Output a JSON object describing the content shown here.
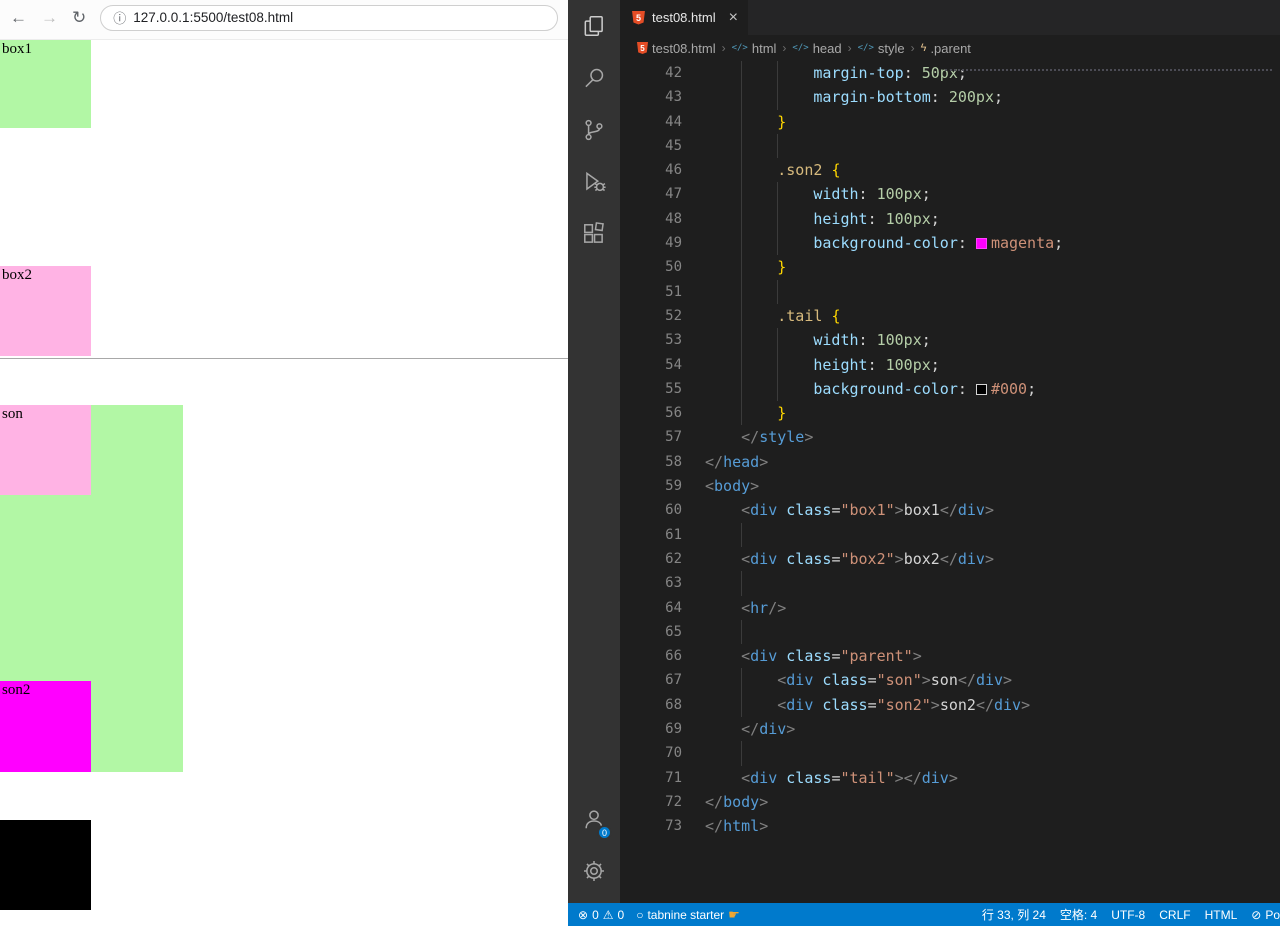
{
  "browser": {
    "toolbar": {
      "back_icon": "←",
      "forward_icon": "→",
      "reload_icon": "↻",
      "info_icon": "ⓘ",
      "url": "127.0.0.1:5500/test08.html"
    },
    "page": {
      "box1": {
        "label": "box1",
        "bg": "#b2f7a5"
      },
      "box2": {
        "label": "box2",
        "bg": "#ffb3e4"
      },
      "parent": {
        "bg": "#b2f7a5"
      },
      "son": {
        "label": "son",
        "bg": "#ffb3e4"
      },
      "son2": {
        "label": "son2",
        "bg": "#ff00ff"
      },
      "tail": {
        "bg": "#000000"
      }
    }
  },
  "vscode": {
    "tab": {
      "title": "test08.html",
      "close_icon": "×",
      "file_icon": "5"
    },
    "breadcrumb": {
      "separator": "›",
      "items": [
        {
          "label": "test08.html",
          "icon": "html5"
        },
        {
          "label": "html",
          "icon": "element"
        },
        {
          "label": "head",
          "icon": "element"
        },
        {
          "label": "style",
          "icon": "element"
        },
        {
          "label": ".parent",
          "icon": "rule"
        }
      ]
    },
    "code": {
      "lines": [
        {
          "n": 42,
          "g": [
            4,
            8
          ],
          "t": [
            [
              "s",
              "            "
            ],
            [
              "p",
              "margin-top"
            ],
            [
              "u",
              ": "
            ],
            [
              "n",
              "50px"
            ],
            [
              "u",
              ";"
            ]
          ]
        },
        {
          "n": 43,
          "g": [
            4,
            8
          ],
          "t": [
            [
              "s",
              "            "
            ],
            [
              "p",
              "margin-bottom"
            ],
            [
              "u",
              ": "
            ],
            [
              "n",
              "200px"
            ],
            [
              "u",
              ";"
            ]
          ]
        },
        {
          "n": 44,
          "g": [
            4
          ],
          "t": [
            [
              "s",
              "        "
            ],
            [
              "b",
              "}"
            ]
          ]
        },
        {
          "n": 45,
          "g": [
            4,
            8
          ],
          "t": []
        },
        {
          "n": 46,
          "g": [
            4
          ],
          "t": [
            [
              "s",
              "        "
            ],
            [
              "c",
              ".son2"
            ],
            [
              "s",
              " "
            ],
            [
              "b",
              "{"
            ]
          ]
        },
        {
          "n": 47,
          "g": [
            4,
            8
          ],
          "t": [
            [
              "s",
              "            "
            ],
            [
              "p",
              "width"
            ],
            [
              "u",
              ": "
            ],
            [
              "n",
              "100px"
            ],
            [
              "u",
              ";"
            ]
          ]
        },
        {
          "n": 48,
          "g": [
            4,
            8
          ],
          "t": [
            [
              "s",
              "            "
            ],
            [
              "p",
              "height"
            ],
            [
              "u",
              ": "
            ],
            [
              "n",
              "100px"
            ],
            [
              "u",
              ";"
            ]
          ]
        },
        {
          "n": 49,
          "g": [
            4,
            8
          ],
          "t": [
            [
              "s",
              "            "
            ],
            [
              "p",
              "background-color"
            ],
            [
              "u",
              ": "
            ],
            [
              "w",
              "#ff00ff"
            ],
            [
              "v",
              "magenta"
            ],
            [
              "u",
              ";"
            ]
          ]
        },
        {
          "n": 50,
          "g": [
            4
          ],
          "t": [
            [
              "s",
              "        "
            ],
            [
              "b",
              "}"
            ]
          ]
        },
        {
          "n": 51,
          "g": [
            4,
            8
          ],
          "t": []
        },
        {
          "n": 52,
          "g": [
            4
          ],
          "t": [
            [
              "s",
              "        "
            ],
            [
              "c",
              ".tail"
            ],
            [
              "s",
              " "
            ],
            [
              "b",
              "{"
            ]
          ]
        },
        {
          "n": 53,
          "g": [
            4,
            8
          ],
          "t": [
            [
              "s",
              "            "
            ],
            [
              "p",
              "width"
            ],
            [
              "u",
              ": "
            ],
            [
              "n",
              "100px"
            ],
            [
              "u",
              ";"
            ]
          ]
        },
        {
          "n": 54,
          "g": [
            4,
            8
          ],
          "t": [
            [
              "s",
              "            "
            ],
            [
              "p",
              "height"
            ],
            [
              "u",
              ": "
            ],
            [
              "n",
              "100px"
            ],
            [
              "u",
              ";"
            ]
          ]
        },
        {
          "n": 55,
          "g": [
            4,
            8
          ],
          "t": [
            [
              "s",
              "            "
            ],
            [
              "p",
              "background-color"
            ],
            [
              "u",
              ": "
            ],
            [
              "w",
              "#000000"
            ],
            [
              "v",
              "#000"
            ],
            [
              "u",
              ";"
            ]
          ]
        },
        {
          "n": 56,
          "g": [
            4
          ],
          "t": [
            [
              "s",
              "        "
            ],
            [
              "b",
              "}"
            ]
          ]
        },
        {
          "n": 57,
          "g": [],
          "t": [
            [
              "s",
              "    "
            ],
            [
              "a",
              "</"
            ],
            [
              "t",
              "style"
            ],
            [
              "a",
              ">"
            ]
          ]
        },
        {
          "n": 58,
          "g": [],
          "t": [
            [
              "a",
              "</"
            ],
            [
              "t",
              "head"
            ],
            [
              "a",
              ">"
            ]
          ]
        },
        {
          "n": 59,
          "g": [],
          "t": [
            [
              "a",
              "<"
            ],
            [
              "t",
              "body"
            ],
            [
              "a",
              ">"
            ]
          ]
        },
        {
          "n": 60,
          "g": [],
          "t": [
            [
              "s",
              "    "
            ],
            [
              "a",
              "<"
            ],
            [
              "t",
              "div"
            ],
            [
              "s",
              " "
            ],
            [
              "r",
              "class"
            ],
            [
              "u",
              "="
            ],
            [
              "q",
              "\"box1\""
            ],
            [
              "a",
              ">"
            ],
            [
              "x",
              "box1"
            ],
            [
              "a",
              "</"
            ],
            [
              "t",
              "div"
            ],
            [
              "a",
              ">"
            ]
          ]
        },
        {
          "n": 61,
          "g": [
            4
          ],
          "t": []
        },
        {
          "n": 62,
          "g": [],
          "t": [
            [
              "s",
              "    "
            ],
            [
              "a",
              "<"
            ],
            [
              "t",
              "div"
            ],
            [
              "s",
              " "
            ],
            [
              "r",
              "class"
            ],
            [
              "u",
              "="
            ],
            [
              "q",
              "\"box2\""
            ],
            [
              "a",
              ">"
            ],
            [
              "x",
              "box2"
            ],
            [
              "a",
              "</"
            ],
            [
              "t",
              "div"
            ],
            [
              "a",
              ">"
            ]
          ]
        },
        {
          "n": 63,
          "g": [
            4
          ],
          "t": []
        },
        {
          "n": 64,
          "g": [],
          "t": [
            [
              "s",
              "    "
            ],
            [
              "a",
              "<"
            ],
            [
              "t",
              "hr"
            ],
            [
              "a",
              "/>"
            ]
          ]
        },
        {
          "n": 65,
          "g": [
            4
          ],
          "t": []
        },
        {
          "n": 66,
          "g": [],
          "t": [
            [
              "s",
              "    "
            ],
            [
              "a",
              "<"
            ],
            [
              "t",
              "div"
            ],
            [
              "s",
              " "
            ],
            [
              "r",
              "class"
            ],
            [
              "u",
              "="
            ],
            [
              "q",
              "\"parent\""
            ],
            [
              "a",
              ">"
            ]
          ]
        },
        {
          "n": 67,
          "g": [
            4
          ],
          "t": [
            [
              "s",
              "        "
            ],
            [
              "a",
              "<"
            ],
            [
              "t",
              "div"
            ],
            [
              "s",
              " "
            ],
            [
              "r",
              "class"
            ],
            [
              "u",
              "="
            ],
            [
              "q",
              "\"son\""
            ],
            [
              "a",
              ">"
            ],
            [
              "x",
              "son"
            ],
            [
              "a",
              "</"
            ],
            [
              "t",
              "div"
            ],
            [
              "a",
              ">"
            ]
          ]
        },
        {
          "n": 68,
          "g": [
            4
          ],
          "t": [
            [
              "s",
              "        "
            ],
            [
              "a",
              "<"
            ],
            [
              "t",
              "div"
            ],
            [
              "s",
              " "
            ],
            [
              "r",
              "class"
            ],
            [
              "u",
              "="
            ],
            [
              "q",
              "\"son2\""
            ],
            [
              "a",
              ">"
            ],
            [
              "x",
              "son2"
            ],
            [
              "a",
              "</"
            ],
            [
              "t",
              "div"
            ],
            [
              "a",
              ">"
            ]
          ]
        },
        {
          "n": 69,
          "g": [],
          "t": [
            [
              "s",
              "    "
            ],
            [
              "a",
              "</"
            ],
            [
              "t",
              "div"
            ],
            [
              "a",
              ">"
            ]
          ]
        },
        {
          "n": 70,
          "g": [
            4
          ],
          "t": []
        },
        {
          "n": 71,
          "g": [],
          "t": [
            [
              "s",
              "    "
            ],
            [
              "a",
              "<"
            ],
            [
              "t",
              "div"
            ],
            [
              "s",
              " "
            ],
            [
              "r",
              "class"
            ],
            [
              "u",
              "="
            ],
            [
              "q",
              "\"tail\""
            ],
            [
              "a",
              ">"
            ],
            [
              "a",
              "</"
            ],
            [
              "t",
              "div"
            ],
            [
              "a",
              ">"
            ]
          ]
        },
        {
          "n": 72,
          "g": [],
          "t": [
            [
              "a",
              "</"
            ],
            [
              "t",
              "body"
            ],
            [
              "a",
              ">"
            ]
          ]
        },
        {
          "n": 73,
          "g": [],
          "t": [
            [
              "a",
              "</"
            ],
            [
              "t",
              "html"
            ],
            [
              "a",
              ">"
            ]
          ]
        }
      ]
    },
    "status_bar": {
      "accent": "#007acc",
      "errors": {
        "icon": "⊗",
        "count": "0"
      },
      "warnings": {
        "icon": "⚠",
        "count": "0"
      },
      "tabnine": {
        "icon": "○",
        "label": "tabnine starter",
        "hand_icon": "☛"
      },
      "right_items": [
        {
          "label": "行 33, 列 24"
        },
        {
          "label": "空格: 4"
        },
        {
          "label": "UTF-8"
        },
        {
          "label": "CRLF"
        },
        {
          "label": "HTML"
        },
        {
          "icon": "⊘",
          "label": "Po"
        }
      ]
    }
  }
}
